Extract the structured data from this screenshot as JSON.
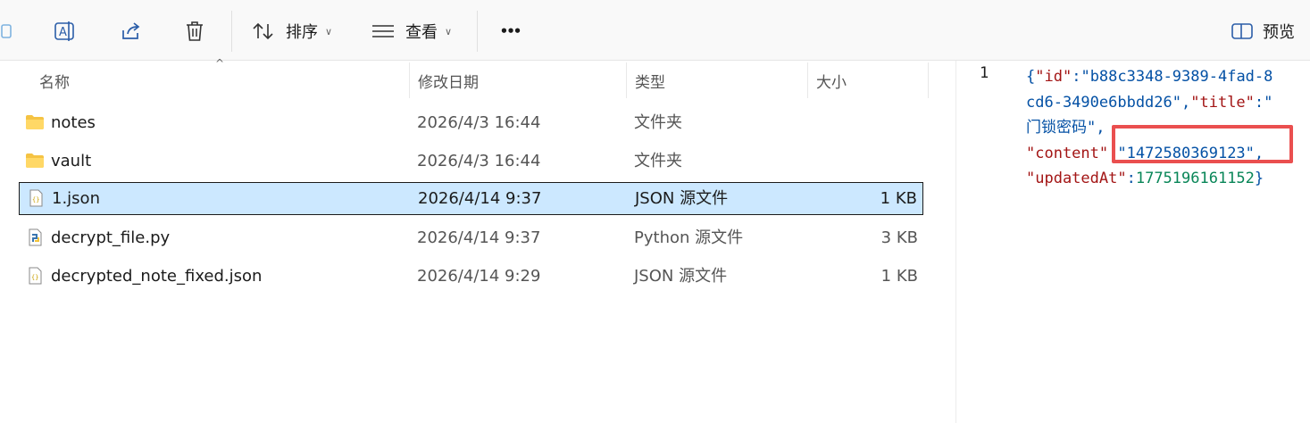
{
  "toolbar": {
    "sort_label": "排序",
    "view_label": "查看",
    "more_label": "•••",
    "preview_label": "预览"
  },
  "columns": {
    "name": "名称",
    "date": "修改日期",
    "type": "类型",
    "size": "大小"
  },
  "files": [
    {
      "name": "notes",
      "date": "2026/4/3 16:44",
      "type": "文件夹",
      "size": "",
      "icon": "folder-icon"
    },
    {
      "name": "vault",
      "date": "2026/4/3 16:44",
      "type": "文件夹",
      "size": "",
      "icon": "folder-icon"
    },
    {
      "name": "1.json",
      "date": "2026/4/14 9:37",
      "type": "JSON 源文件",
      "size": "1 KB",
      "icon": "json-file-icon",
      "selected": true
    },
    {
      "name": "decrypt_file.py",
      "date": "2026/4/14 9:37",
      "type": "Python 源文件",
      "size": "3 KB",
      "icon": "python-file-icon"
    },
    {
      "name": "decrypted_note_fixed.json",
      "date": "2026/4/14 9:29",
      "type": "JSON 源文件",
      "size": "1 KB",
      "icon": "json-file-icon"
    }
  ],
  "preview": {
    "line_number": "1",
    "lines": [
      [
        [
          "p",
          "{"
        ],
        [
          "k",
          "\"id\""
        ],
        [
          "p",
          ":"
        ],
        [
          "s",
          "\"b88c3348-9389-4fad-8"
        ]
      ],
      [
        [
          "s",
          "cd6-3490e6bbdd26\""
        ],
        [
          "p",
          ","
        ],
        [
          "k",
          "\"title\""
        ],
        [
          "p",
          ":"
        ],
        [
          "s",
          "\""
        ]
      ],
      [
        [
          "s",
          "门锁密码\""
        ],
        [
          "p",
          ","
        ]
      ],
      [
        [
          "k",
          "\"content\""
        ],
        [
          "p",
          ":"
        ],
        [
          "s",
          "\"1472580369123\""
        ],
        [
          "p",
          ","
        ]
      ],
      [
        [
          "k",
          "\"updatedAt\""
        ],
        [
          "p",
          ":"
        ],
        [
          "n",
          "1775196161152"
        ],
        [
          "p",
          "}"
        ]
      ]
    ]
  },
  "colors": {
    "selection": "#cce8ff",
    "highlight_box": "#ea4f4f",
    "json_key": "#a31515",
    "json_string": "#0451a5",
    "json_number": "#098658"
  }
}
